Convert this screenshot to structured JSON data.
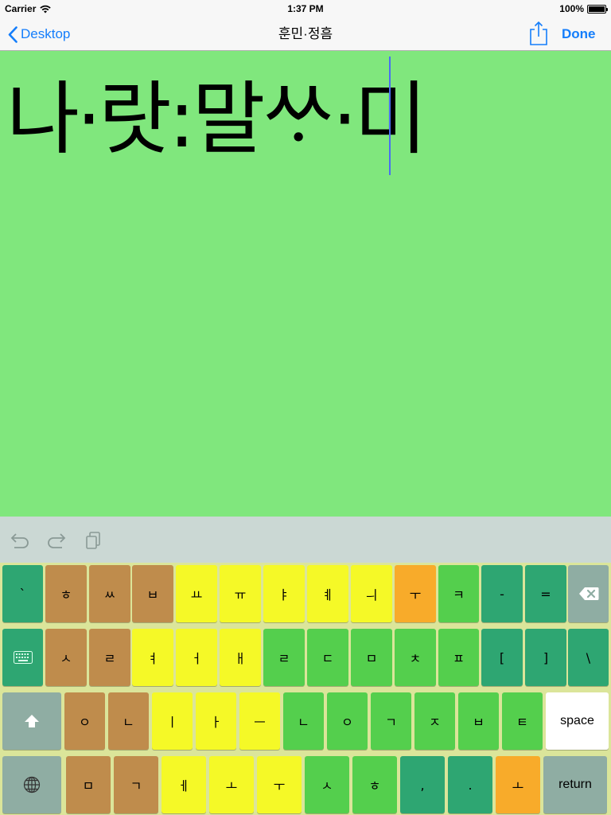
{
  "status_bar": {
    "carrier": "Carrier",
    "time": "1:37 PM",
    "battery": "100%",
    "battery_level": 1.0
  },
  "nav_bar": {
    "back_label": "Desktop",
    "title": "훈민·정흠",
    "done_label": "Done",
    "icons": [
      "chevron-left-icon",
      "share-icon"
    ]
  },
  "editor": {
    "text": "나·랏:말ᄊᆞ·미",
    "background": "#80e77d",
    "caret_color": "#4a6df2"
  },
  "toolbar": {
    "icons": [
      "undo-icon",
      "redo-icon",
      "paste-icon"
    ]
  },
  "colors": {
    "brown": "#bf8c4c",
    "yellow": "#f5f927",
    "orange": "#f8ab2a",
    "light_green": "#54cf4d",
    "dark_green": "#2ea672",
    "gray": "#8fada3",
    "white": "#ffffff",
    "keyboard_bg": "#dbe59a",
    "ios_blue": "#157efb"
  },
  "keyboard": {
    "row1": [
      {
        "label": "`",
        "color": "dark_green"
      },
      {
        "label": "ㅎ",
        "color": "brown"
      },
      {
        "label": "ㅆ",
        "color": "brown"
      },
      {
        "label": "ㅂ",
        "color": "brown"
      },
      {
        "label": "ㅛ",
        "color": "yellow"
      },
      {
        "label": "ㅠ",
        "color": "yellow"
      },
      {
        "label": "ㅑ",
        "color": "yellow"
      },
      {
        "label": "ㅖ",
        "color": "yellow"
      },
      {
        "label": "ㅢ",
        "color": "yellow"
      },
      {
        "label": "ㅜ",
        "color": "orange"
      },
      {
        "label": "ㅋ",
        "color": "light_green"
      },
      {
        "label": "-",
        "color": "dark_green"
      },
      {
        "label": "=",
        "color": "dark_green"
      },
      {
        "label": "",
        "icon": "backspace-icon",
        "color": "gray"
      }
    ],
    "row2": [
      {
        "label": "",
        "icon": "keyboard-icon",
        "color": "dark_green"
      },
      {
        "label": "ㅅ",
        "color": "brown"
      },
      {
        "label": "ㄹ",
        "color": "brown"
      },
      {
        "label": "ㅕ",
        "color": "yellow"
      },
      {
        "label": "ㅓ",
        "color": "yellow"
      },
      {
        "label": "ㅐ",
        "color": "yellow"
      },
      {
        "label": "ㄹ",
        "color": "light_green"
      },
      {
        "label": "ㄷ",
        "color": "light_green"
      },
      {
        "label": "ㅁ",
        "color": "light_green"
      },
      {
        "label": "ㅊ",
        "color": "light_green"
      },
      {
        "label": "ㅍ",
        "color": "light_green"
      },
      {
        "label": "[",
        "color": "dark_green"
      },
      {
        "label": "]",
        "color": "dark_green"
      },
      {
        "label": "\\",
        "color": "dark_green"
      }
    ],
    "row3": [
      {
        "label": "",
        "icon": "shift-icon",
        "color": "gray"
      },
      {
        "label": "ㅇ",
        "color": "brown"
      },
      {
        "label": "ㄴ",
        "color": "brown"
      },
      {
        "label": "ㅣ",
        "color": "yellow"
      },
      {
        "label": "ㅏ",
        "color": "yellow"
      },
      {
        "label": "ㅡ",
        "color": "yellow"
      },
      {
        "label": "ㄴ",
        "color": "light_green"
      },
      {
        "label": "ㅇ",
        "color": "light_green"
      },
      {
        "label": "ㄱ",
        "color": "light_green"
      },
      {
        "label": "ㅈ",
        "color": "light_green"
      },
      {
        "label": "ㅂ",
        "color": "light_green"
      },
      {
        "label": "ㅌ",
        "color": "light_green"
      },
      {
        "label": "space",
        "color": "white"
      }
    ],
    "row4": [
      {
        "label": "",
        "icon": "globe-icon",
        "color": "gray"
      },
      {
        "label": "ㅁ",
        "color": "brown"
      },
      {
        "label": "ㄱ",
        "color": "brown"
      },
      {
        "label": "ㅔ",
        "color": "yellow"
      },
      {
        "label": "ㅗ",
        "color": "yellow"
      },
      {
        "label": "ㅜ",
        "color": "yellow"
      },
      {
        "label": "ㅅ",
        "color": "light_green"
      },
      {
        "label": "ㅎ",
        "color": "light_green"
      },
      {
        "label": ",",
        "color": "dark_green"
      },
      {
        "label": ".",
        "color": "dark_green"
      },
      {
        "label": "ㅗ",
        "color": "orange"
      },
      {
        "label": "return",
        "color": "gray"
      }
    ]
  }
}
